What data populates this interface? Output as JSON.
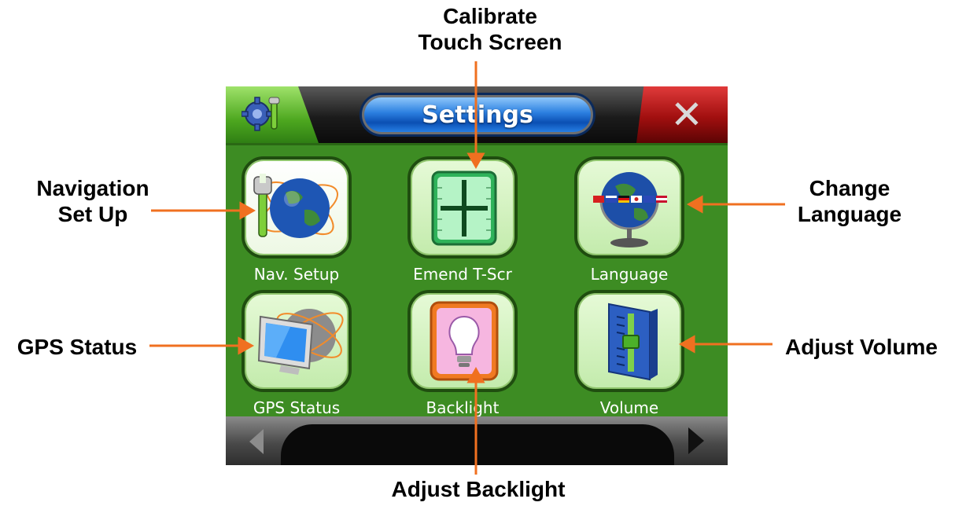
{
  "window": {
    "title": "Settings",
    "close_glyph": "✕",
    "settings_icon": "gear-wrench-icon",
    "prev_icon": "triangle-left-icon",
    "next_icon": "triangle-right-icon"
  },
  "tiles": [
    {
      "label": "Nav. Setup",
      "icon": "globe-wrench-icon",
      "selected": true
    },
    {
      "label": "Emend T-Scr",
      "icon": "crosshair-icon",
      "selected": false
    },
    {
      "label": "Language",
      "icon": "globe-flags-icon",
      "selected": false
    },
    {
      "label": "GPS Status",
      "icon": "monitor-globe-icon",
      "selected": false
    },
    {
      "label": "Backlight",
      "icon": "lightbulb-icon",
      "selected": false
    },
    {
      "label": "Volume",
      "icon": "volume-slider-icon",
      "selected": false
    }
  ],
  "callouts": {
    "calibrate_line1": "Calibrate",
    "calibrate_line2": "Touch Screen",
    "navigation_line1": "Navigation",
    "navigation_line2": "Set Up",
    "change_line1": "Change",
    "change_line2": "Language",
    "gps_status": "GPS Status",
    "adjust_volume": "Adjust Volume",
    "adjust_backlight": "Adjust Backlight"
  },
  "colors": {
    "callout_arrow": "#f07020",
    "screen_green": "#3d8c23",
    "title_blue": "#2b7fe0",
    "close_red": "#b01414"
  }
}
